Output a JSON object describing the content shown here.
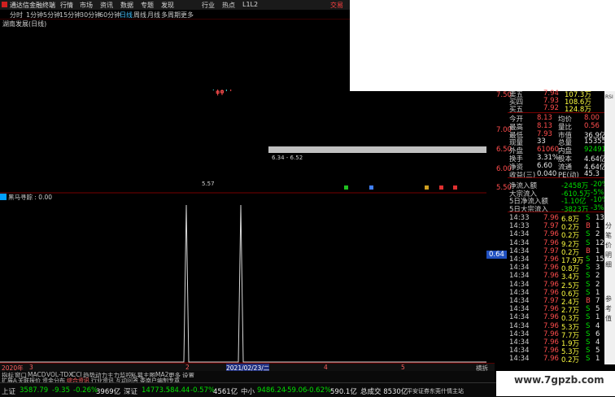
{
  "menu": {
    "brand": "通达信金融终端",
    "items": [
      "行情",
      "市场",
      "资讯",
      "数据",
      "专题",
      "发现",
      "行业",
      "热点",
      "L1L2"
    ],
    "trade": "交易"
  },
  "periods": [
    "分时",
    "1分钟",
    "5分钟",
    "15分钟",
    "30分钟",
    "60分钟",
    "日线",
    "周线",
    "月线",
    "多周期",
    "更多"
  ],
  "active_period": "日线",
  "stock_title": "湖南发展(日线)",
  "chart_labels": {
    "low_price": "5.57",
    "range": "6.34 - 6.52",
    "indicator_title": "黑马寻踪 : 0.00",
    "date_mid": "2021/02/23/二",
    "year_label": "2020年",
    "axis_ticks": [
      "3",
      "2",
      "3",
      "4",
      "5"
    ],
    "right_end": "横拆"
  },
  "price_axis": [
    "7.50",
    "7.00",
    "6.50",
    "6.00",
    "5.50"
  ],
  "right_marks": [
    "0.64"
  ],
  "quote": {
    "asks": [
      {
        "label": "卖五",
        "price": "7.94",
        "vol": "107.3万"
      },
      {
        "label": "买四",
        "price": "7.93",
        "vol": "108.6万"
      },
      {
        "label": "买五",
        "price": "7.92",
        "vol": "124.8万"
      }
    ],
    "fields": [
      {
        "l1": "今开",
        "v1": "8.13",
        "l2": "均价",
        "v2": "8.00"
      },
      {
        "l1": "最高",
        "v1": "8.13",
        "l2": "量比",
        "v2": "0.56"
      },
      {
        "l1": "最低",
        "v1": "7.93",
        "l2": "市值",
        "v2": "36.9亿"
      },
      {
        "l1": "现量",
        "v1": "33",
        "l2": "总量",
        "v2": "153551"
      },
      {
        "l1": "外盘",
        "v1": "61060",
        "l2": "内盘",
        "v2": "92491"
      },
      {
        "l1": "换手",
        "v1": "3.31%",
        "l2": "股本",
        "v2": "4.64亿"
      },
      {
        "l1": "净资",
        "v1": "6.60",
        "l2": "流通",
        "v2": "4.64亿"
      },
      {
        "l1": "收益(三)",
        "v1": "0.040",
        "l2": "PE(动)",
        "v2": "45.3"
      }
    ],
    "flows": [
      {
        "label": "净流入额",
        "value": "-2458万",
        "pct": "-20%"
      },
      {
        "label": "大宗流入",
        "value": "-610.5万",
        "pct": "-5%"
      },
      {
        "label": "5日净流入额",
        "value": "-1.10亿",
        "pct": "-10%"
      },
      {
        "label": "5日大宗流入",
        "value": "-3823万",
        "pct": "-3%"
      }
    ],
    "ticks": [
      {
        "t": "14:33",
        "p": "7.96",
        "v": "6.8万",
        "s": "S",
        "n": "13"
      },
      {
        "t": "14:33",
        "p": "7.97",
        "v": "0.2万",
        "s": "B",
        "n": "1"
      },
      {
        "t": "14:34",
        "p": "7.96",
        "v": "0.2万",
        "s": "S",
        "n": "2"
      },
      {
        "t": "14:34",
        "p": "7.96",
        "v": "9.2万",
        "s": "S",
        "n": "12"
      },
      {
        "t": "14:34",
        "p": "7.97",
        "v": "0.2万",
        "s": "B",
        "n": "1"
      },
      {
        "t": "14:34",
        "p": "7.96",
        "v": "17.9万",
        "s": "S",
        "n": "15"
      },
      {
        "t": "14:34",
        "p": "7.96",
        "v": "0.8万",
        "s": "S",
        "n": "3"
      },
      {
        "t": "14:34",
        "p": "7.96",
        "v": "3.4万",
        "s": "S",
        "n": "2"
      },
      {
        "t": "14:34",
        "p": "7.96",
        "v": "2.5万",
        "s": "S",
        "n": "2"
      },
      {
        "t": "14:34",
        "p": "7.96",
        "v": "0.6万",
        "s": "S",
        "n": "1"
      },
      {
        "t": "14:34",
        "p": "7.97",
        "v": "2.4万",
        "s": "B",
        "n": "7"
      },
      {
        "t": "14:34",
        "p": "7.96",
        "v": "2.7万",
        "s": "S",
        "n": "5"
      },
      {
        "t": "14:34",
        "p": "7.96",
        "v": "0.3万",
        "s": "S",
        "n": "1"
      },
      {
        "t": "14:34",
        "p": "7.96",
        "v": "5.3万",
        "s": "S",
        "n": "4"
      },
      {
        "t": "14:34",
        "p": "7.96",
        "v": "7.7万",
        "s": "S",
        "n": "6"
      },
      {
        "t": "14:34",
        "p": "7.96",
        "v": "1.9万",
        "s": "S",
        "n": "4"
      },
      {
        "t": "14:34",
        "p": "7.96",
        "v": "5.3万",
        "s": "S",
        "n": "5"
      },
      {
        "t": "14:34",
        "p": "7.96",
        "v": "0.2万",
        "s": "S",
        "n": "1"
      }
    ]
  },
  "tabs_row1": [
    "指标",
    "窗口",
    "MACD",
    "VOL-TDX",
    "CCI",
    "趋势动力",
    "主力监控",
    "私募主图",
    "MA2",
    "更多",
    "设置"
  ],
  "tabs_row2": [
    "扩展A",
    "关联报价",
    "资金分布",
    "综合资讯",
    "行业资讯",
    "互动问答",
    "委南户编制专章"
  ],
  "index_bar": [
    {
      "name": "上证",
      "val": "3587.79",
      "chg": "-9.35",
      "pct": "-0.26%",
      "amt": "3969亿"
    },
    {
      "name": "深证",
      "val": "14773.5",
      "chg": "-84.44",
      "pct": "-0.57%",
      "amt": "4561亿"
    },
    {
      "name": "中小",
      "val": "9486.24",
      "chg": "-59.06",
      "pct": "-0.62%",
      "amt": "590.1亿"
    }
  ],
  "total_amt": "总成交  8530亿",
  "broker": "平安证券东莞什情主站",
  "watermark": "www.7gpzb.com",
  "side_tabs": [
    "RSI",
    "分",
    "笔",
    "价",
    "明",
    "细",
    "参",
    "考",
    "值"
  ],
  "colors": {
    "up": "#ff4d4d",
    "down": "#40e0e0",
    "background": "#000000"
  }
}
